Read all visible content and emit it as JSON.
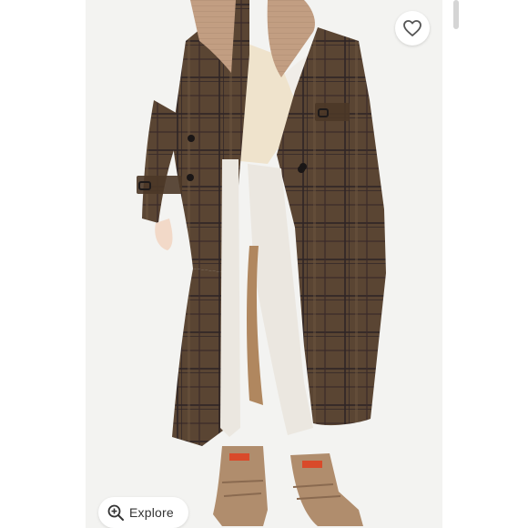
{
  "product_image": {
    "alt": "",
    "colors": {
      "coat": "#5a4533",
      "plaid": "#2e2426",
      "collar": "#c29e82",
      "hoodie": "#efe3cc",
      "pants": "#ebe7e0",
      "boots": "#b08d6d"
    }
  },
  "like_button": {
    "icon": "heart-outline-icon",
    "color": "#555555"
  },
  "explore_button": {
    "label": "Explore",
    "icon": "zoom-in-icon"
  }
}
